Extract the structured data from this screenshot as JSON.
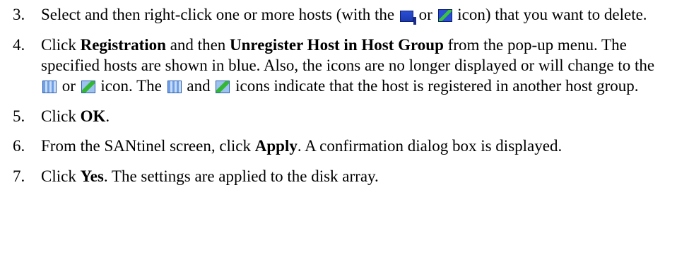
{
  "steps": [
    {
      "num": "3.",
      "t1": "Select and then right-click one or more hosts (with the",
      "t2": "or",
      "t3": "icon) that you want to delete."
    },
    {
      "num": "4.",
      "t1": "Click ",
      "b1": "Registration",
      "t2": " and then ",
      "b2": "Unregister Host in Host Group",
      "t3": " from the pop-up menu. The specified hosts are shown in blue. Also, the icons are no longer displayed or will change to the",
      "t4": "or",
      "t5": "icon. The",
      "t6": "and",
      "t7": "icons indicate that the host is registered in another host group."
    },
    {
      "num": "5.",
      "t1": "Click ",
      "b1": "OK",
      "t2": "."
    },
    {
      "num": "6.",
      "t1": "From the SANtinel screen, click ",
      "b1": "Apply",
      "t2": ". A confirmation dialog box is displayed."
    },
    {
      "num": "7.",
      "t1": "Click ",
      "b1": "Yes",
      "t2": ". The settings are applied to the disk array."
    }
  ],
  "icons": {
    "host": "host-icon",
    "host_edit": "host-edit-icon",
    "other_group": "host-other-group-icon",
    "other_group_edit": "host-other-group-edit-icon"
  }
}
